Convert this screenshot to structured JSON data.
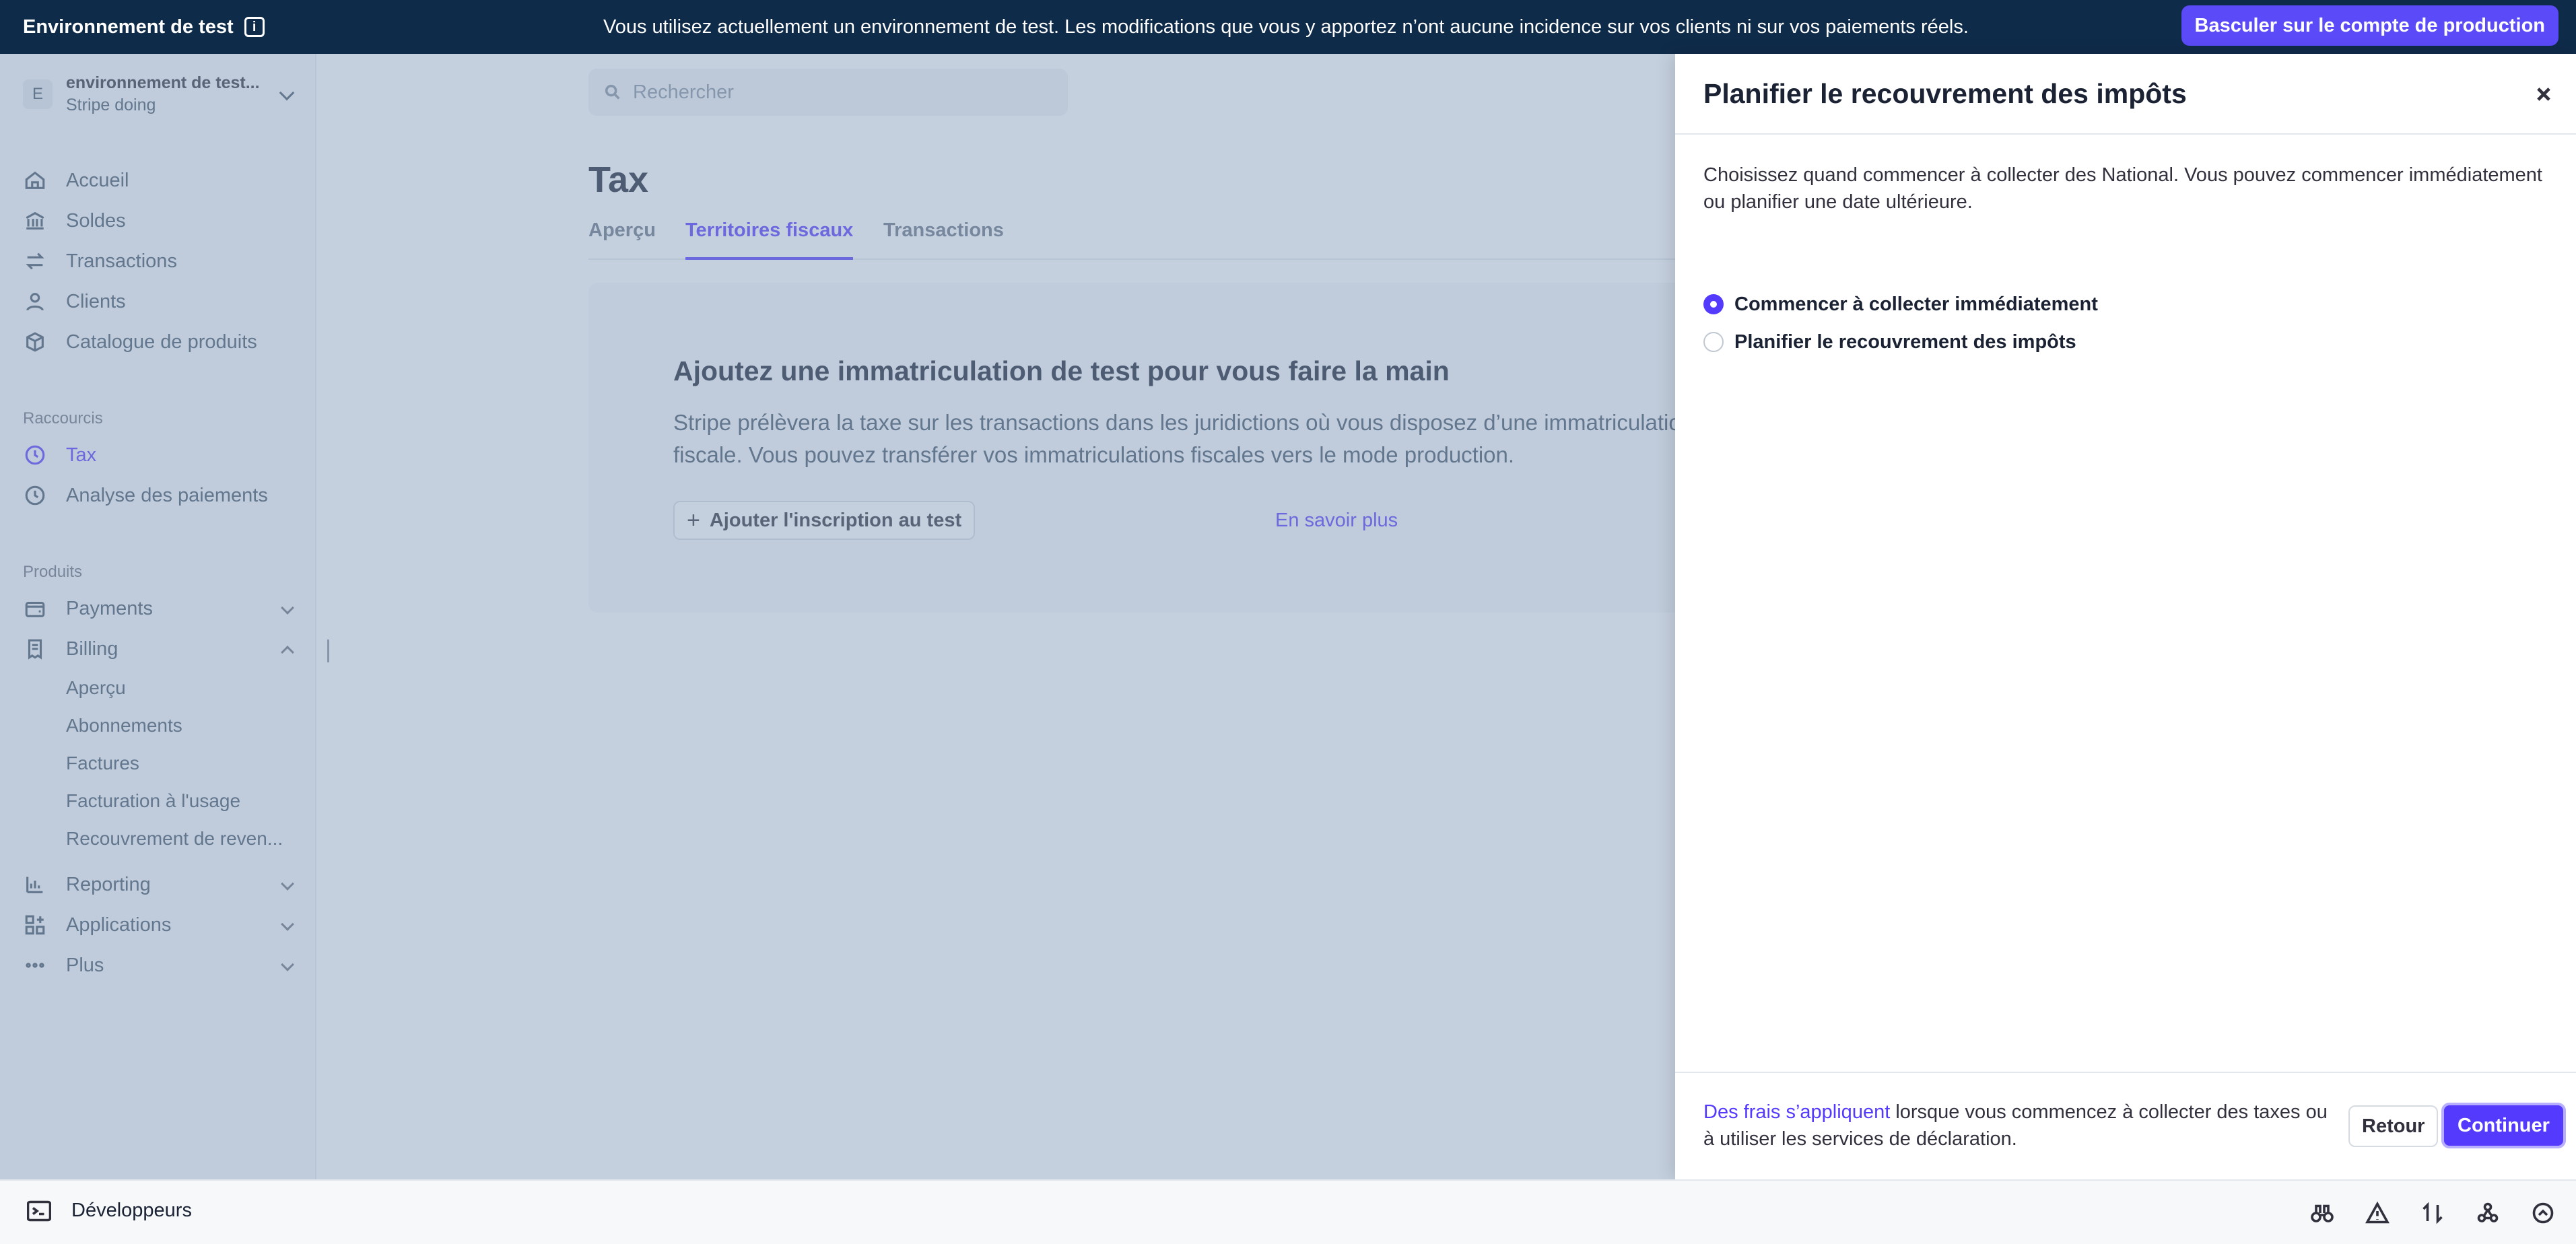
{
  "banner": {
    "env_label": "Environnement de test",
    "message": "Vous utilisez actuellement un environnement de test. Les modifications que vous y apportez n’ont aucune incidence sur vos clients ni sur vos paiements réels.",
    "prod_button": "Basculer sur le compte de production"
  },
  "account": {
    "initial": "E",
    "name": "environnement de test...",
    "subtitle": "Stripe doing"
  },
  "sidebar": {
    "items": [
      {
        "label": "Accueil",
        "icon": "home-icon"
      },
      {
        "label": "Soldes",
        "icon": "balances-icon"
      },
      {
        "label": "Transactions",
        "icon": "transactions-icon"
      },
      {
        "label": "Clients",
        "icon": "user-icon"
      },
      {
        "label": "Catalogue de produits",
        "icon": "box-icon"
      }
    ],
    "shortcuts_label": "Raccourcis",
    "shortcuts": [
      {
        "label": "Tax",
        "icon": "clock-icon"
      },
      {
        "label": "Analyse des paiements",
        "icon": "clock-icon"
      }
    ],
    "products_label": "Produits",
    "products": [
      {
        "label": "Payments",
        "icon": "wallet-icon"
      },
      {
        "label": "Billing",
        "icon": "billing-icon"
      }
    ],
    "billing_sub": [
      "Aperçu",
      "Abonnements",
      "Factures",
      "Facturation à l'usage",
      "Recouvrement de reven..."
    ],
    "more": [
      {
        "label": "Reporting",
        "icon": "chart-icon"
      },
      {
        "label": "Applications",
        "icon": "apps-icon"
      },
      {
        "label": "Plus",
        "icon": "more-icon"
      }
    ]
  },
  "main": {
    "search_placeholder": "Rechercher",
    "title": "Tax",
    "tabs": [
      "Aperçu",
      "Territoires fiscaux",
      "Transactions"
    ],
    "active_tab": "Territoires fiscaux",
    "card": {
      "heading": "Ajoutez une immatriculation de test pour vous faire la main",
      "text": "Stripe prélèvera la taxe sur les transactions dans les juridictions où vous disposez d’une immatriculation fiscale. Vous pouvez transférer vos immatriculations fiscales vers le mode production.",
      "add_button": "Ajouter l'inscription au test",
      "learn_more": "En savoir plus"
    }
  },
  "drawer": {
    "title": "Planifier le recouvrement des impôts",
    "description": "Choisissez quand commencer à collecter des National. Vous pouvez commencer immédiatement ou planifier une date ultérieure.",
    "options": [
      {
        "label": "Commencer à collecter immédiatement",
        "selected": true
      },
      {
        "label": "Planifier le recouvrement des impôts",
        "selected": false
      }
    ],
    "footer_link": "Des frais s’appliquent",
    "footer_text": " lorsque vous commencez à collecter des taxes ou à utiliser les services de déclaration.",
    "back_button": "Retour",
    "continue_button": "Continuer"
  },
  "devbar": {
    "label": "Développeurs"
  },
  "colors": {
    "accent": "#533afd",
    "banner_bg": "#0f2b4a",
    "banner_button": "#5a4af8"
  }
}
